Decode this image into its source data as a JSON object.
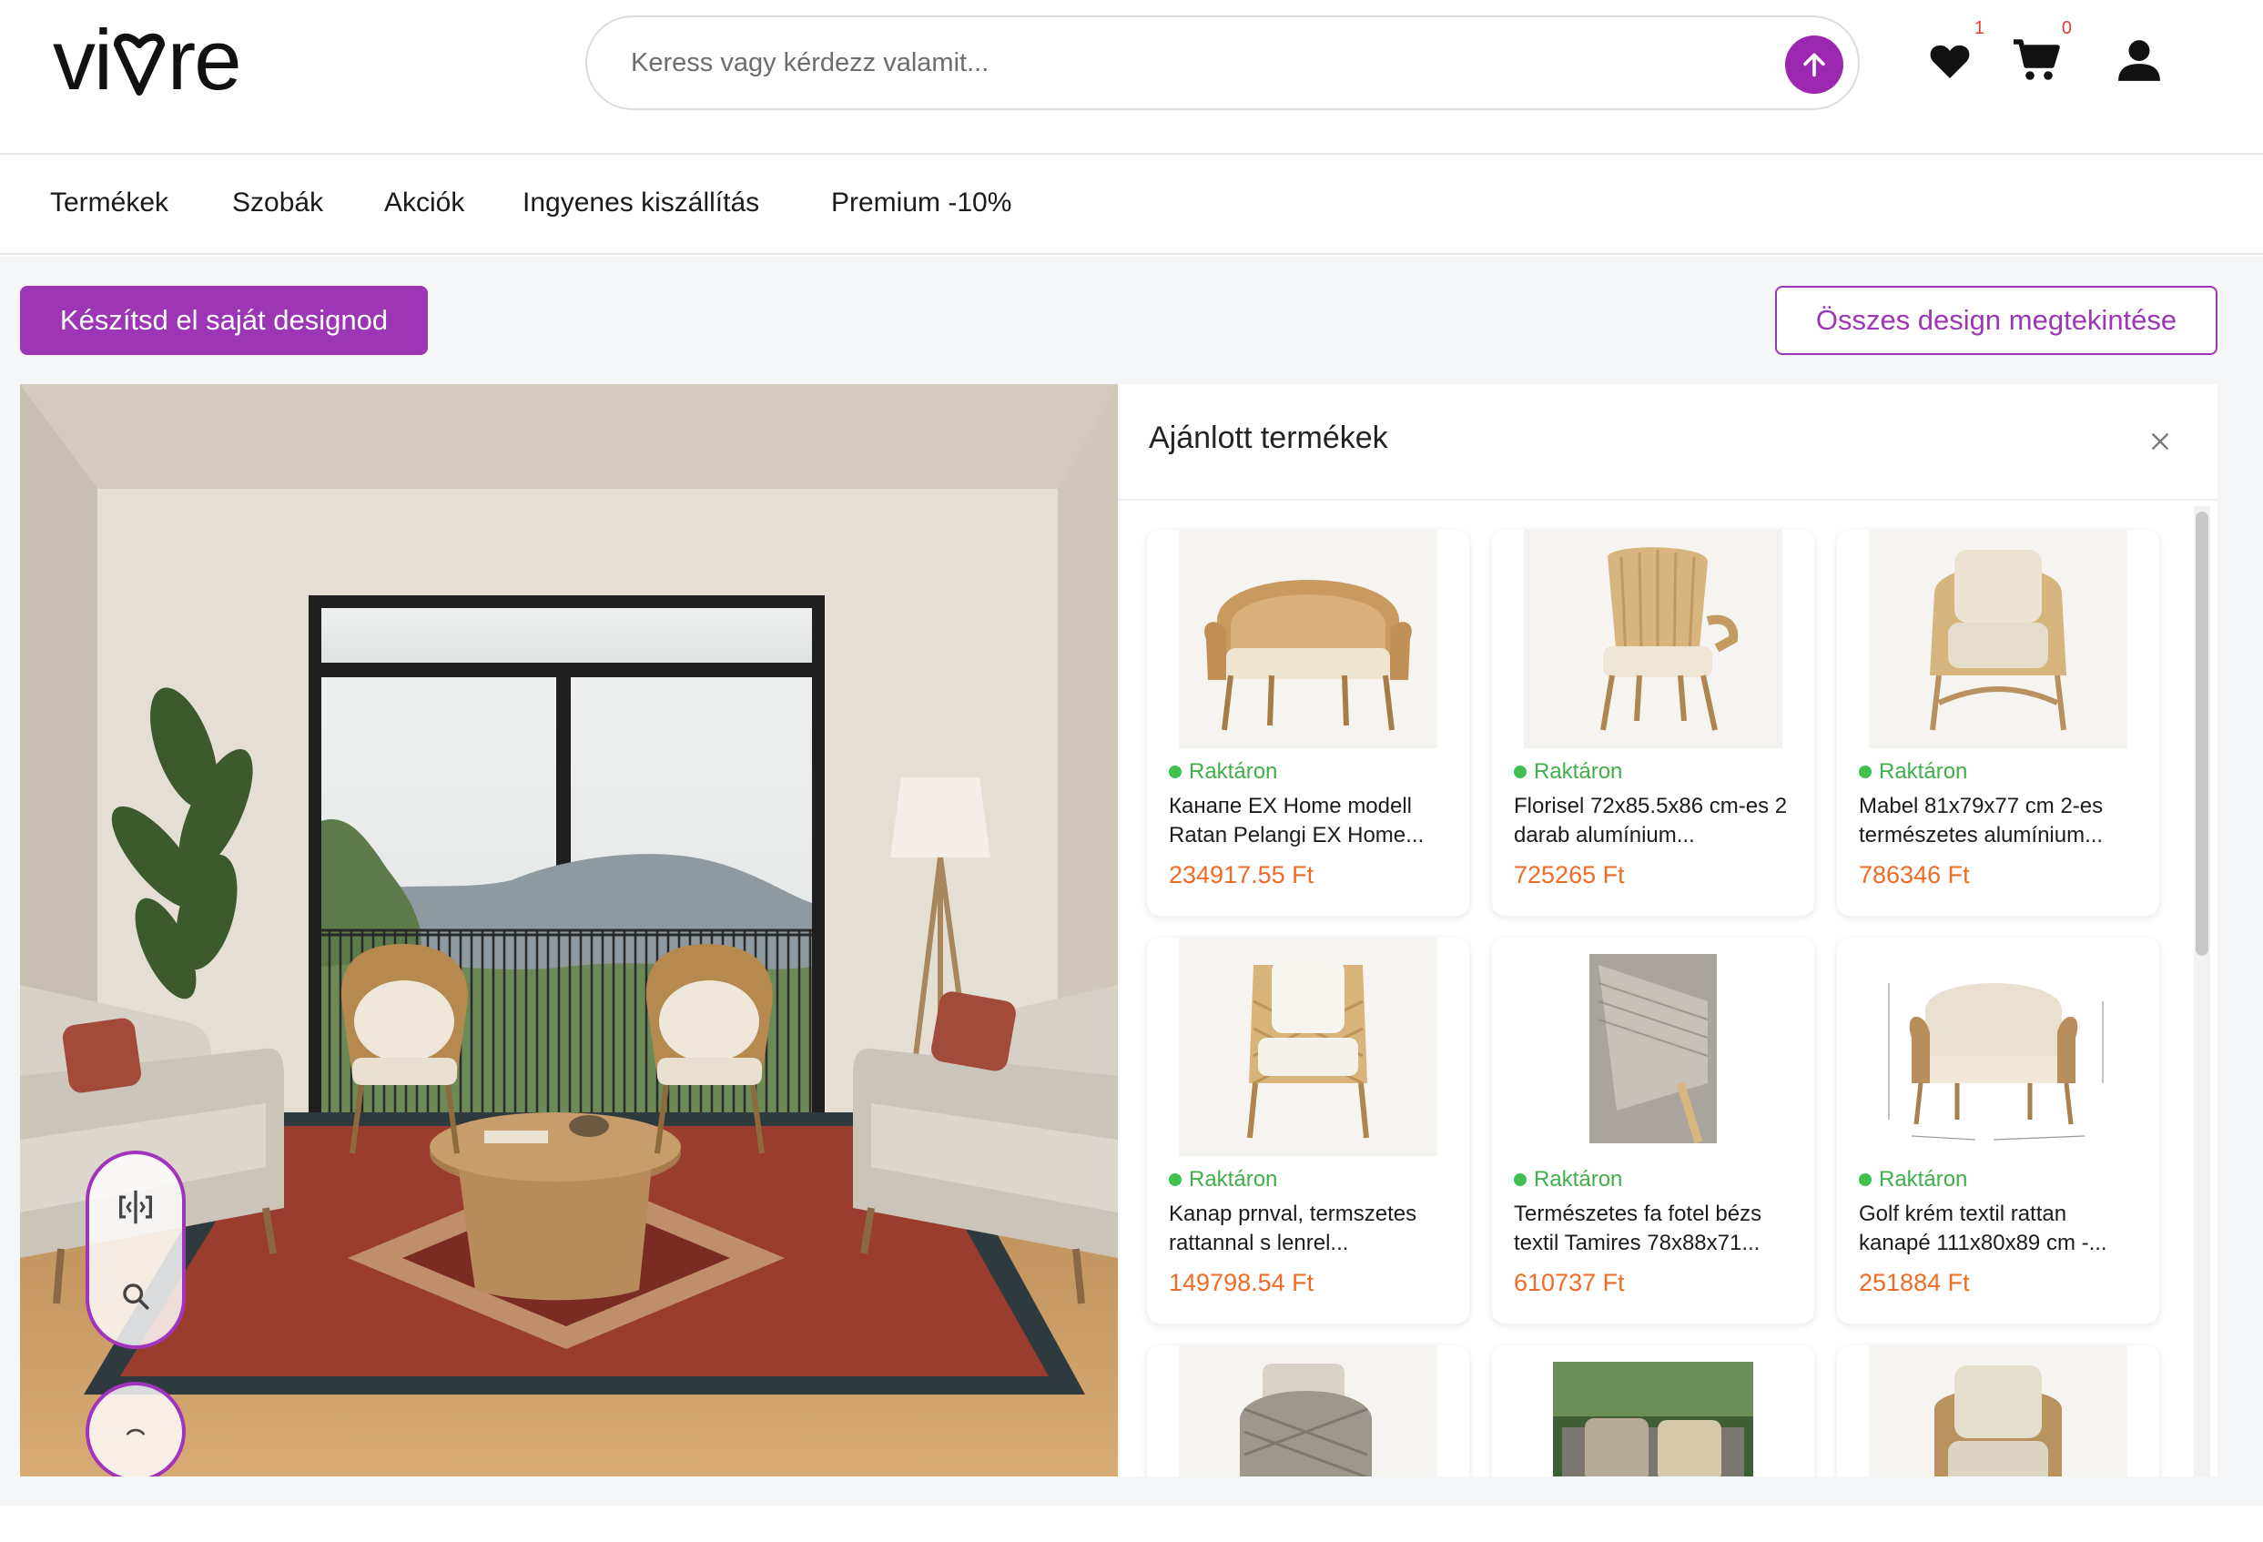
{
  "brand": {
    "logo_text": "vivre",
    "accent": "#9c36b5"
  },
  "search": {
    "placeholder": "Keress vagy kérdezz valamit..."
  },
  "header_icons": {
    "wishlist": {
      "icon": "heart-icon",
      "count": "1"
    },
    "cart": {
      "icon": "cart-icon",
      "count": "0"
    },
    "account": {
      "icon": "user-icon"
    }
  },
  "nav": {
    "items": [
      "Termékek",
      "Szobák",
      "Akciók",
      "Ingyenes kiszállítás",
      "Premium -10%"
    ]
  },
  "actions": {
    "create_label": "Készítsd el saját designod",
    "view_all_label": "Összes design megtekintése"
  },
  "room_tools": {
    "icons": [
      "compare-icon",
      "zoom-icon",
      "collapse-icon"
    ]
  },
  "panel": {
    "title": "Ajánlott termékek",
    "close_icon": "close-icon",
    "products": [
      {
        "stock": "Raktáron",
        "name": "Канапе EX Home modell Ratan Pelangi EX Home...",
        "price": "234917.55 Ft"
      },
      {
        "stock": "Raktáron",
        "name": "Florisel 72x85.5x86 cm-es 2 darab alumínium...",
        "price": "725265 Ft"
      },
      {
        "stock": "Raktáron",
        "name": "Mabel 81x79x77 cm 2-es természetes alumínium...",
        "price": "786346 Ft"
      },
      {
        "stock": "Raktáron",
        "name": "Kanap prnval, termszetes rattannal s lenrel...",
        "price": "149798.54 Ft"
      },
      {
        "stock": "Raktáron",
        "name": "Természetes fa fotel bézs textil Tamires 78x88x71...",
        "price": "610737 Ft"
      },
      {
        "stock": "Raktáron",
        "name": "Golf krém textil rattan kanapé 111x80x89 cm -...",
        "price": "251884 Ft"
      }
    ]
  }
}
